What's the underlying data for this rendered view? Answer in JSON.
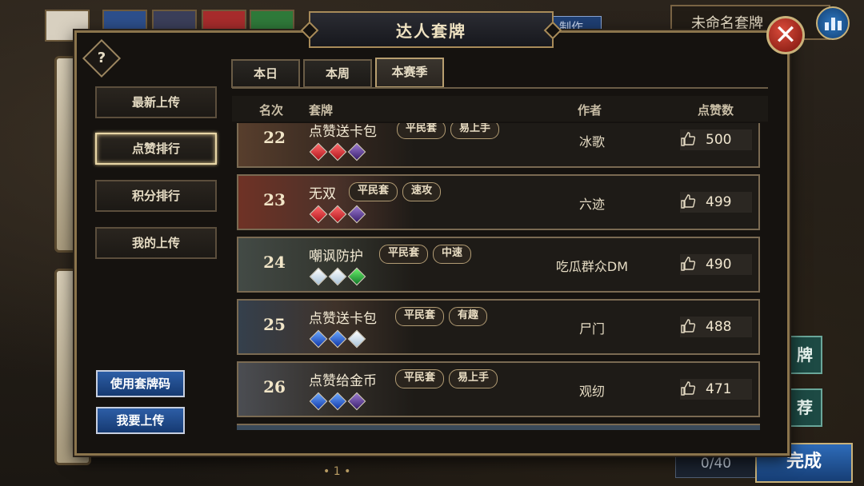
{
  "dialog": {
    "title": "达人套牌",
    "help_icon": "?",
    "close_icon": "close-icon"
  },
  "left_menu": [
    {
      "label": "最新上传",
      "active": false
    },
    {
      "label": "点赞排行",
      "active": true
    },
    {
      "label": "积分排行",
      "active": false
    },
    {
      "label": "我的上传",
      "active": false
    }
  ],
  "bottom_buttons": {
    "use_code": "使用套牌码",
    "upload": "我要上传"
  },
  "tabs": [
    {
      "label": "本日",
      "active": false
    },
    {
      "label": "本周",
      "active": false
    },
    {
      "label": "本赛季",
      "active": true
    }
  ],
  "columns": {
    "rank": "名次",
    "deck": "套牌",
    "author": "作者",
    "likes": "点赞数"
  },
  "rows": [
    {
      "rank": "22",
      "name": "点赞送卡包",
      "tags": [
        "平民套",
        "易上手"
      ],
      "gems": [
        "red",
        "red",
        "purple"
      ],
      "author": "冰歌",
      "likes": "500"
    },
    {
      "rank": "23",
      "name": "无双",
      "tags": [
        "平民套",
        "速攻"
      ],
      "gems": [
        "red",
        "red",
        "purple"
      ],
      "author": "六迹",
      "likes": "499"
    },
    {
      "rank": "24",
      "name": "嘲讽防护",
      "tags": [
        "平民套",
        "中速"
      ],
      "gems": [
        "white",
        "white",
        "green"
      ],
      "author": "吃瓜群众DM",
      "likes": "490"
    },
    {
      "rank": "25",
      "name": "点赞送卡包",
      "tags": [
        "平民套",
        "有趣"
      ],
      "gems": [
        "blue",
        "blue",
        "white"
      ],
      "author": "尸门",
      "likes": "488"
    },
    {
      "rank": "26",
      "name": "点赞给金币",
      "tags": [
        "平民套",
        "易上手"
      ],
      "gems": [
        "blue",
        "blue",
        "purple"
      ],
      "author": "观纫",
      "likes": "471"
    }
  ],
  "background": {
    "deck_name": "未命名套牌",
    "make_button": "制作",
    "side_button_1": "牌",
    "side_button_2": "荐",
    "card_count": "0/40",
    "done_button": "完成",
    "page_indicator": "• 1 •"
  },
  "colors": {
    "accent_gold": "#a88b59",
    "active_highlight": "#e8d6a6",
    "blue_button": "#2d5ea6",
    "close_red": "#d94a3a"
  }
}
